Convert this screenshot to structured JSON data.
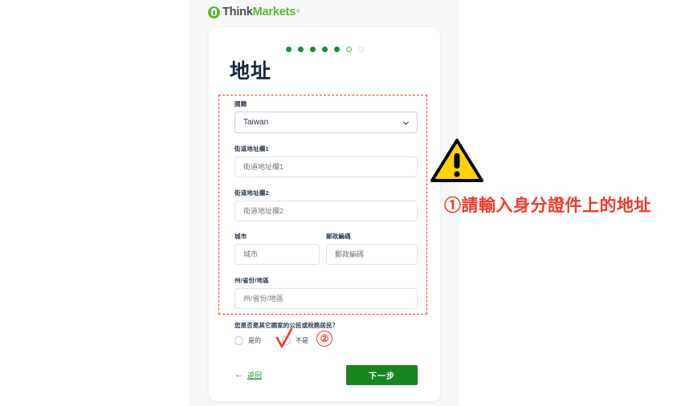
{
  "brand": {
    "icon": "thinkmarkets-logo-icon",
    "name_part1": "Think",
    "name_part2": "Markets",
    "trademark": "®"
  },
  "progress": {
    "total_steps": 7,
    "completed": 5,
    "current_index": 5,
    "states": [
      "filled",
      "filled",
      "filled",
      "filled",
      "filled",
      "current",
      "empty"
    ]
  },
  "page_title": "地址",
  "form": {
    "country": {
      "label": "國籍",
      "value": "Taiwan",
      "chevron_icon": "chevron-down-icon"
    },
    "street1": {
      "label": "街道地址欄1",
      "value": "",
      "placeholder": "街道地址欄1"
    },
    "street2": {
      "label": "街道地址欄2",
      "value": "",
      "placeholder": "街道地址欄2"
    },
    "city": {
      "label": "城市",
      "value": "",
      "placeholder": "城市"
    },
    "postal_code": {
      "label": "郵政編碼",
      "value": "",
      "placeholder": "郵政編碼"
    },
    "state_province": {
      "label": "州/省份/地區",
      "value": "",
      "placeholder": "州/省份/地區"
    }
  },
  "question": {
    "text": "您是否是其它國家的公民或稅務居民？",
    "options": [
      {
        "label": "是的",
        "selected": false
      },
      {
        "label": "不是",
        "selected": false
      }
    ]
  },
  "footer": {
    "back_arrow": "←",
    "back_label": "返回",
    "next_label": "下一步"
  },
  "annotations": {
    "warning_icon": "warning-triangle-icon",
    "note_1": "①請輸入身分證件上的地址",
    "marker_2": "②",
    "checkmark_icon": "red-checkmark-icon",
    "highlight_color": "#f0392b"
  },
  "colors": {
    "brand_green": "#5cb531",
    "button_green": "#19851f",
    "title_navy": "#16263d",
    "annotation_red": "#f0392b",
    "warning_yellow": "#ffd400",
    "page_background": "#f7f8f9"
  }
}
